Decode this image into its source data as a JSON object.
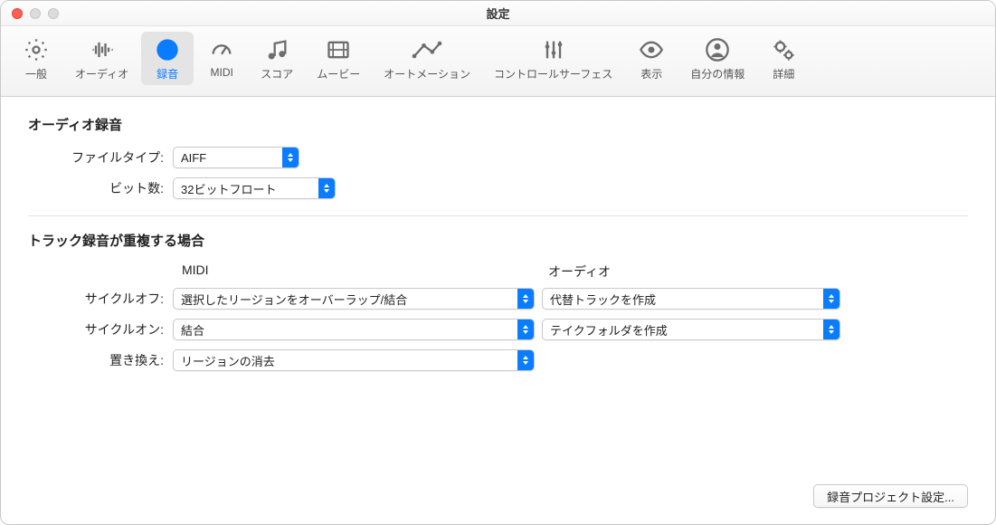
{
  "window": {
    "title": "設定"
  },
  "toolbar": {
    "items": [
      {
        "label": "一般"
      },
      {
        "label": "オーディオ"
      },
      {
        "label": "録音"
      },
      {
        "label": "MIDI"
      },
      {
        "label": "スコア"
      },
      {
        "label": "ムービー"
      },
      {
        "label": "オートメーション"
      },
      {
        "label": "コントロールサーフェス"
      },
      {
        "label": "表示"
      },
      {
        "label": "自分の情報"
      },
      {
        "label": "詳細"
      }
    ]
  },
  "audio_recording": {
    "title": "オーディオ録音",
    "file_type_label": "ファイルタイプ:",
    "file_type_value": "AIFF",
    "bit_depth_label": "ビット数:",
    "bit_depth_value": "32ビットフロート"
  },
  "overlapping": {
    "title": "トラック録音が重複する場合",
    "col_midi": "MIDI",
    "col_audio": "オーディオ",
    "cycle_off_label": "サイクルオフ:",
    "cycle_off_midi": "選択したリージョンをオーバーラップ/結合",
    "cycle_off_audio": "代替トラックを作成",
    "cycle_on_label": "サイクルオン:",
    "cycle_on_midi": "結合",
    "cycle_on_audio": "テイクフォルダを作成",
    "replace_label": "置き換え:",
    "replace_value": "リージョンの消去"
  },
  "footer": {
    "button": "録音プロジェクト設定..."
  }
}
